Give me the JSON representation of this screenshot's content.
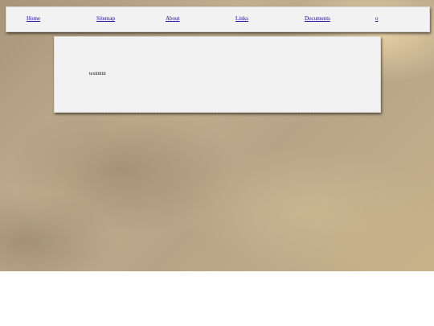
{
  "nav": {
    "items": [
      {
        "label": "Home"
      },
      {
        "label": "Sitemap"
      },
      {
        "label": "About"
      },
      {
        "label": "Links"
      },
      {
        "label": "Documents"
      },
      {
        "label": "o"
      }
    ]
  },
  "content": {
    "text": "textttttttt"
  }
}
